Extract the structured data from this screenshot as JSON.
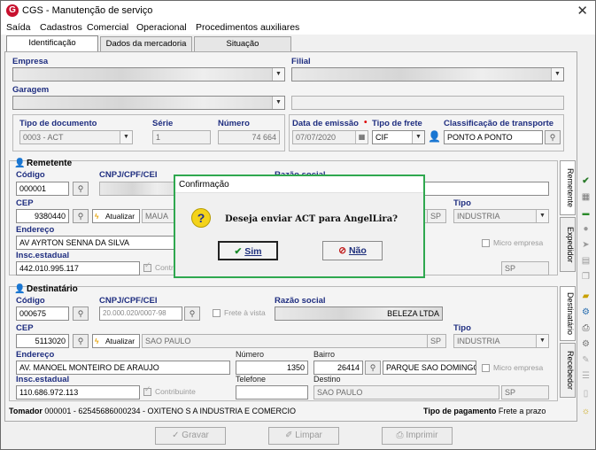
{
  "window": {
    "title": "CGS - Manutenção de serviço",
    "app_icon": "G"
  },
  "menu": [
    "Saída",
    "Cadastros",
    "Comercial",
    "Operacional",
    "Procedimentos auxiliares"
  ],
  "tabs": [
    "Identificação",
    "Dados da mercadoria",
    "Situação"
  ],
  "header": {
    "empresa_label": "Empresa",
    "filial_label": "Filial",
    "garagem_label": "Garagem",
    "tipo_doc_label": "Tipo de documento",
    "tipo_doc_value": "0003 - ACT",
    "serie_label": "Série",
    "serie_value": "1",
    "numero_label": "Número",
    "numero_value": "74 664",
    "data_emissao_label": "Data de emissão",
    "data_emissao_value": "07/07/2020",
    "tipo_frete_label": "Tipo de frete",
    "tipo_frete_value": "CIF",
    "classificacao_label": "Classificação de transporte",
    "classificacao_value": "PONTO A PONTO"
  },
  "remetente": {
    "title": "Remetente",
    "codigo_label": "Código",
    "codigo_value": "000001",
    "cnpj_label": "CNPJ/CPF/CEI",
    "razao_label": "Razão social",
    "cep_label": "CEP",
    "cep_value": "9380440",
    "atualizar_label": "Atualizar",
    "cidade_value": "MAUA",
    "uf_value": "SP",
    "tipo_label": "Tipo",
    "tipo_value": "INDUSTRIA",
    "micro_empresa_label": "Micro empresa",
    "endereco_label": "Endereço",
    "endereco_value": "AV AYRTON SENNA DA SILVA",
    "insc_label": "Insc.estadual",
    "insc_value": "442.010.995.117",
    "contribuinte_label": "Contribuinte",
    "uf2_value": "SP"
  },
  "destinatario": {
    "title": "Destinatário",
    "codigo_label": "Código",
    "codigo_value": "000675",
    "cnpj_label": "CNPJ/CPF/CEI",
    "cnpj_value": "20.000.020/0007-98",
    "frete_vista_label": "Frete à vista",
    "razao_label": "Razão social",
    "razao_value": "BELEZA LTDA",
    "cep_label": "CEP",
    "cep_value": "5113020",
    "atualizar_label": "Atualizar",
    "cidade_value": "SAO PAULO",
    "uf_value": "SP",
    "tipo_label": "Tipo",
    "tipo_value": "INDUSTRIA",
    "endereco_label": "Endereço",
    "endereco_value": "AV. MANOEL MONTEIRO DE ARAUJO",
    "numero_label": "Número",
    "numero_value": "1350",
    "bairro_label": "Bairro",
    "bairro_code": "26414",
    "bairro_value": "PARQUE SAO DOMINGO",
    "micro_empresa_label": "Micro empresa",
    "insc_label": "Insc.estadual",
    "insc_value": "110.686.972.113",
    "contribuinte_label": "Contribuinte",
    "telefone_label": "Telefone",
    "destino_label": "Destino",
    "destino_value": "SAO PAULO",
    "destino_uf": "SP"
  },
  "side_tabs": [
    "Remetente",
    "Expedidor",
    "Destinatário",
    "Recebedor"
  ],
  "tomador": {
    "label": "Tomador",
    "value": "000001 - 62545686000234 - OXITENO S A INDUSTRIA E COMERCIO"
  },
  "pagamento": {
    "label": "Tipo de pagamento",
    "value": "Frete a prazo"
  },
  "bottom_buttons": [
    "Gravar",
    "Limpar",
    "Imprimir"
  ],
  "dialog": {
    "title": "Confirmação",
    "message": "Deseja enviar ACT para AngelLira?",
    "yes": "Sim",
    "no": "Não",
    "accent": "#2fa84f"
  }
}
